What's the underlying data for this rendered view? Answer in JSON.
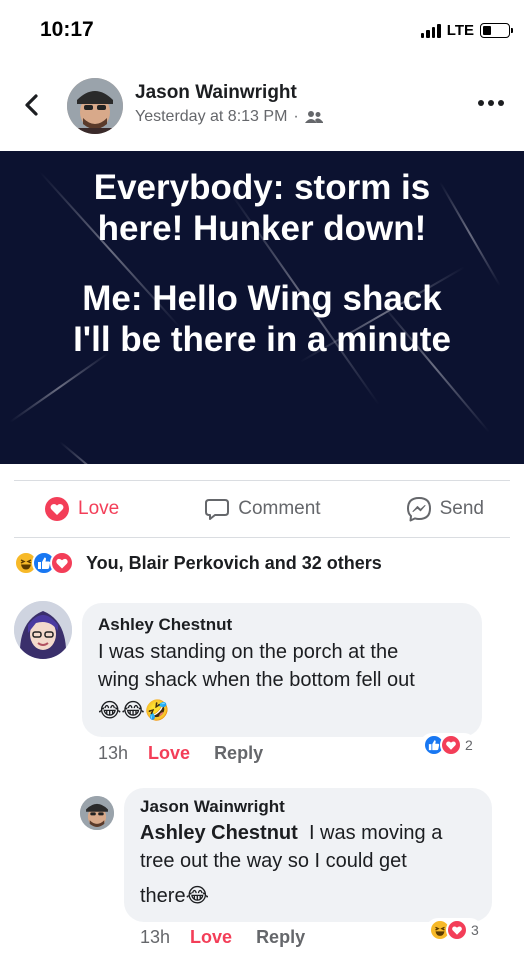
{
  "status_bar": {
    "time": "10:17",
    "network": "LTE",
    "battery_level": 0.35
  },
  "post": {
    "author": "Jason Wainwright",
    "timestamp": "Yesterday at 8:13 PM",
    "separator": "·",
    "audience_icon": "friends-icon",
    "image_text": {
      "line1": "Everybody: storm is",
      "line2": "here!  Hunker down!",
      "line3": "Me: Hello Wing shack",
      "line4": "I'll be there in a minute"
    },
    "image_background": "#0c1230"
  },
  "actions": {
    "love": "Love",
    "comment": "Comment",
    "send": "Send"
  },
  "reactions_summary": {
    "text": "You, Blair Perkovich and 32 others",
    "icons": [
      "haha-icon",
      "like-icon",
      "love-icon"
    ]
  },
  "comments": [
    {
      "name": "Ashley Chestnut",
      "text_line1": "I was standing on the porch at the",
      "text_line2": "wing shack when the bottom fell out",
      "emojis": "😂😂🤣",
      "time": "13h",
      "love_label": "Love",
      "reply_label": "Reply",
      "reaction_count": "2",
      "reaction_icons": [
        "like-icon",
        "love-icon"
      ]
    },
    {
      "name": "Jason Wainwright",
      "mention": "Ashley Chestnut",
      "text_part1": "I was moving a",
      "text_line2": "tree out the way  so I could get",
      "text_line3": "there",
      "emoji": "😂",
      "time": "13h",
      "love_label": "Love",
      "reply_label": "Reply",
      "reaction_count": "3",
      "reaction_icons": [
        "haha-icon",
        "love-icon"
      ]
    }
  ],
  "colors": {
    "love": "#f33e58",
    "like": "#1877f2",
    "haha": "#f7b928",
    "secondary_text": "#65676b",
    "bubble": "#f0f2f5"
  }
}
